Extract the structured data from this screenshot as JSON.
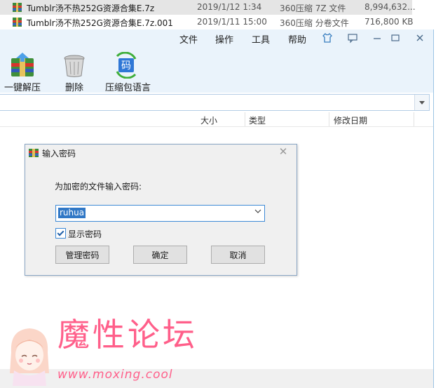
{
  "files": [
    {
      "name": "Tumblr汤不热252G资源合集E.7z",
      "date": "2019/1/12 1:34",
      "type": "360压缩 7Z 文件",
      "size": "8,994,632..."
    },
    {
      "name": "Tumblr汤不热252G资源合集E.7z.001",
      "date": "2019/1/11 15:00",
      "type": "360压缩 分卷文件",
      "size": "716,800 KB"
    }
  ],
  "menu": {
    "file": "文件",
    "operate": "操作",
    "tools": "工具",
    "help": "帮助"
  },
  "toolbar": {
    "extract": "一键解压",
    "delete": "删除",
    "language": "压缩包语言"
  },
  "columns": {
    "size": "大小",
    "type": "类型",
    "modified": "修改日期"
  },
  "dialog": {
    "title": "输入密码",
    "prompt": "为加密的文件输入密码:",
    "password": "ruhua",
    "show_password": "显示密码",
    "manage": "管理密码",
    "ok": "确定",
    "cancel": "取消"
  },
  "watermark": {
    "title": "魔性论坛",
    "url": "www.moxing.cool"
  },
  "colors": {
    "accent": "#3e8ad6",
    "menubar": "#eaf3fb",
    "watermark": "#ff5f8a"
  }
}
